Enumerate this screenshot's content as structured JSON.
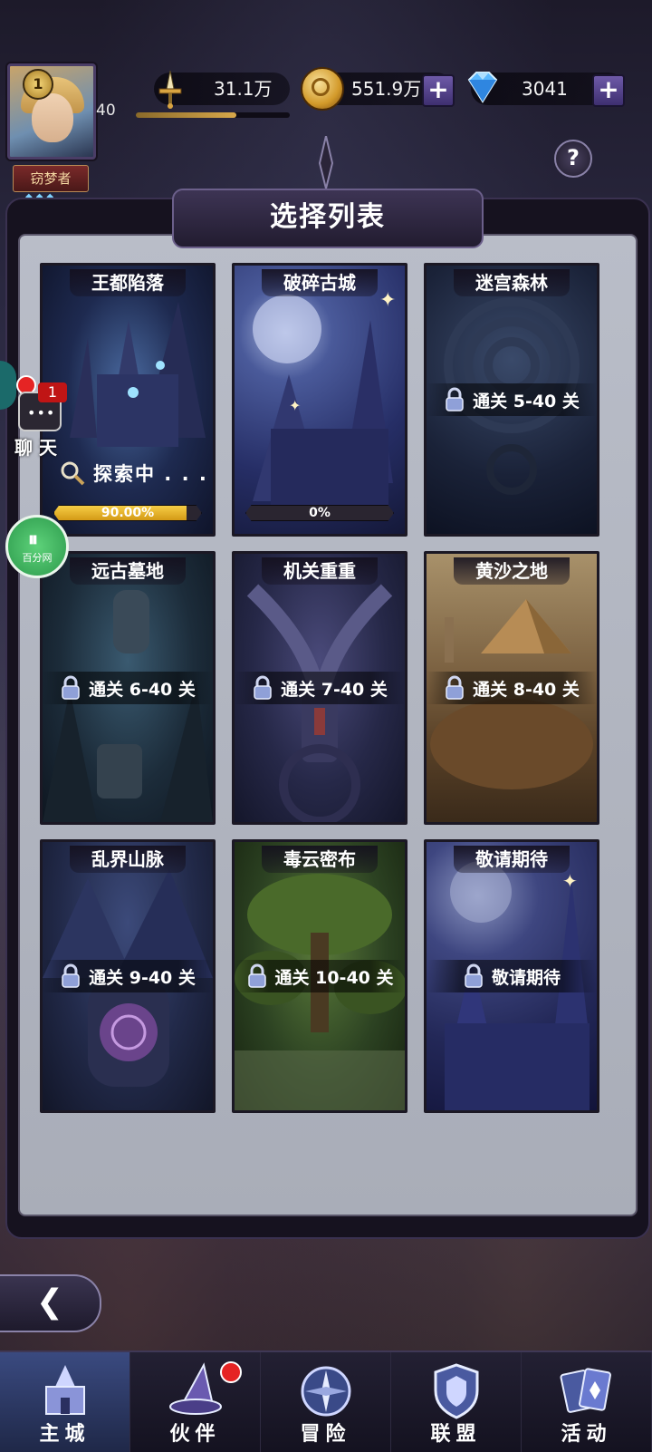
{
  "player": {
    "level": "1",
    "title": "窃梦者",
    "xp_level": "40"
  },
  "resources": {
    "power": "31.1万",
    "gold": "551.9万",
    "gems": "3041"
  },
  "help": {
    "label": "?"
  },
  "panel": {
    "title": "选择列表"
  },
  "cards": [
    {
      "name": "王都陷落",
      "status": "探索中 . . .",
      "progress_text": "90.00%",
      "progress": 0.9
    },
    {
      "name": "破碎古城",
      "progress_text": "0%",
      "progress": 0.0
    },
    {
      "name": "迷宫森林",
      "lock": "通关 5-40 关"
    },
    {
      "name": "远古墓地",
      "lock": "通关 6-40 关"
    },
    {
      "name": "机关重重",
      "lock": "通关 7-40 关"
    },
    {
      "name": "黄沙之地",
      "lock": "通关 8-40 关"
    },
    {
      "name": "乱界山脉",
      "lock": "通关 9-40 关"
    },
    {
      "name": "毒云密布",
      "lock": "通关 10-40 关"
    },
    {
      "name": "敬请期待",
      "lock": "敬请期待"
    }
  ],
  "side": {
    "chat_badge": "1",
    "chat_label": "聊 天",
    "green_badge": "百分网"
  },
  "nav": [
    {
      "label": "主城",
      "active": true
    },
    {
      "label": "伙伴",
      "dot": true
    },
    {
      "label": "冒险"
    },
    {
      "label": "联盟"
    },
    {
      "label": "活动"
    }
  ],
  "colors": {
    "progress_gold": "#f5cd45",
    "plus_button": "#6e5aa8",
    "nav_active": "#3a4a80"
  }
}
